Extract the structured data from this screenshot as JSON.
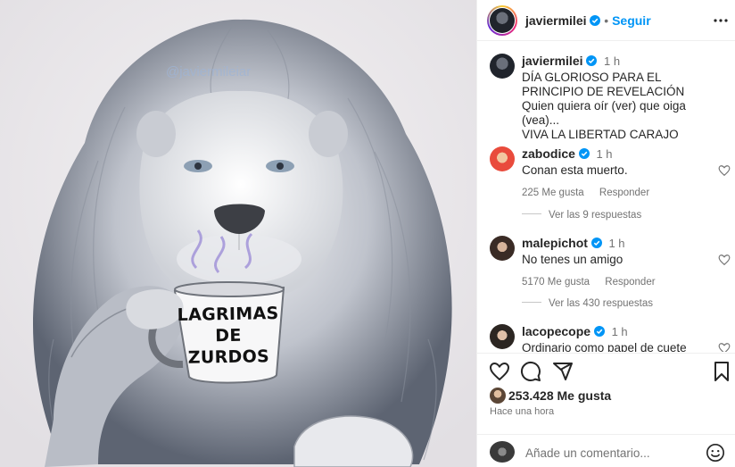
{
  "media": {
    "watermark": "@javiermileiar",
    "mug_text": "LAGRIMAS\nDE ZURDOS"
  },
  "header": {
    "username": "javiermilei",
    "separator": "•",
    "follow_label": "Seguir",
    "more_icon": "more-horizontal-icon"
  },
  "caption": {
    "username": "javiermilei",
    "time": "1 h",
    "text": "DÍA GLORIOSO PARA EL PRINCIPIO DE REVELACIÓN\nQuien quiera oír (ver) que oiga (vea)...\nVIVA LA LIBERTAD CARAJO"
  },
  "comments": [
    {
      "username": "zabodice",
      "time": "1 h",
      "text": "Conan esta muerto.",
      "likes": "225 Me gusta",
      "reply_label": "Responder",
      "view_replies": "Ver las 9 respuestas"
    },
    {
      "username": "malepichot",
      "time": "1 h",
      "text": "No tenes un amigo",
      "likes": "5170 Me gusta",
      "reply_label": "Responder",
      "view_replies": "Ver las 430 respuestas"
    },
    {
      "username": "lacopecope",
      "time": "1 h",
      "text": "Ordinario como papel de cuete"
    }
  ],
  "actions": {
    "like_icon": "heart-icon",
    "comment_icon": "comment-icon",
    "share_icon": "share-icon",
    "save_icon": "bookmark-icon",
    "likes_count": "253.428 Me gusta",
    "time_ago": "Hace una hora"
  },
  "composer": {
    "placeholder": "Añade un comentario...",
    "emoji_icon": "emoji-icon"
  },
  "colors": {
    "accent": "#0095f6",
    "verified": "#0095f6",
    "text": "#262626",
    "muted": "#737373"
  }
}
